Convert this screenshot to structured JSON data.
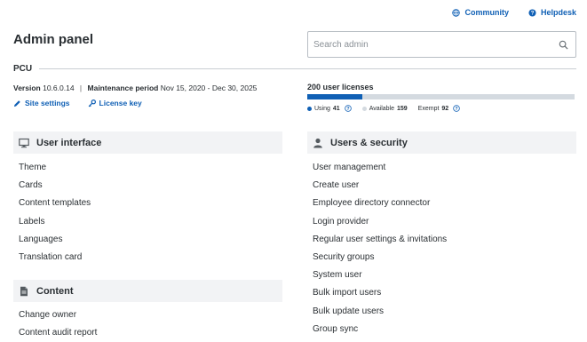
{
  "top_links": {
    "community": "Community",
    "helpdesk": "Helpdesk"
  },
  "page_title": "Admin panel",
  "search": {
    "placeholder": "Search admin"
  },
  "pcu": {
    "label": "PCU",
    "version_label": "Version",
    "version_value": "10.6.0.14",
    "separator": "|",
    "maintenance_label": "Maintenance period",
    "maintenance_value": "Nov 15, 2020 - Dec 30, 2025",
    "site_settings": "Site settings",
    "license_key": "License key"
  },
  "licenses": {
    "title": "200 user licenses",
    "total": 200,
    "using_label": "Using",
    "using_value": "41",
    "available_label": "Available",
    "available_value": "159",
    "exempt_label": "Exempt",
    "exempt_value": "92",
    "colors": {
      "using": "#1060b5",
      "available": "#d4dae0"
    }
  },
  "sections": {
    "user_interface": {
      "title": "User interface",
      "icon": "monitor-icon",
      "items": [
        "Theme",
        "Cards",
        "Content templates",
        "Labels",
        "Languages",
        "Translation card"
      ]
    },
    "content": {
      "title": "Content",
      "icon": "document-icon",
      "items": [
        "Change owner",
        "Content audit report"
      ]
    },
    "users_security": {
      "title": "Users & security",
      "icon": "user-icon",
      "items": [
        "User management",
        "Create user",
        "Employee directory connector",
        "Login provider",
        "Regular user settings & invitations",
        "Security groups",
        "System user",
        "Bulk import users",
        "Bulk update users",
        "Group sync"
      ]
    }
  },
  "colors": {
    "accent": "#1060b5",
    "section_bg": "#f2f3f5",
    "text": "#2a2f33"
  }
}
